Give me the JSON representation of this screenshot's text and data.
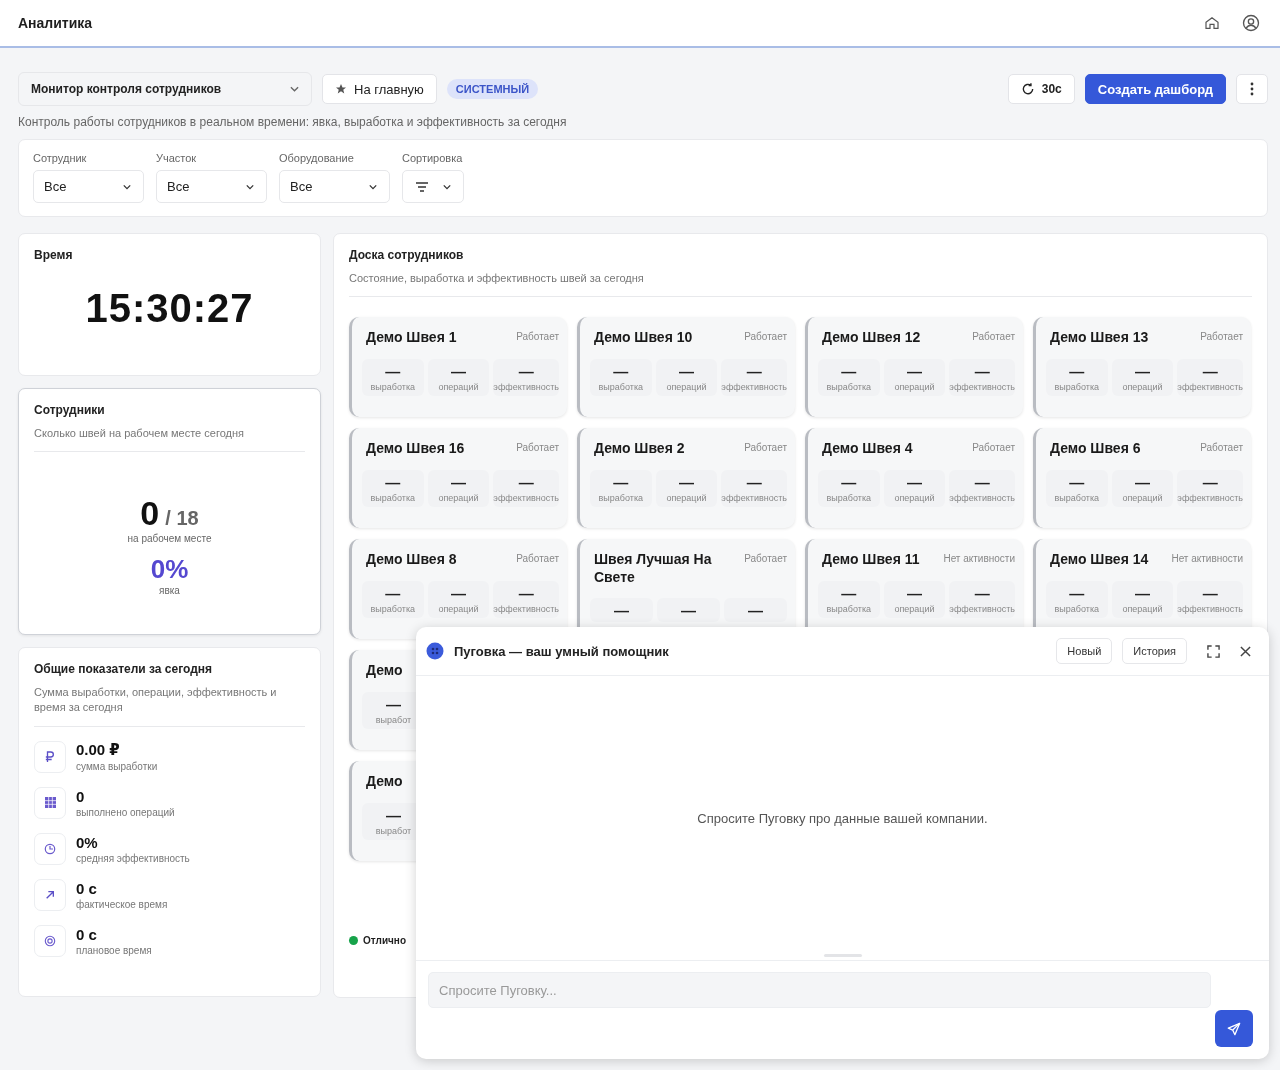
{
  "header": {
    "title": "Аналитика"
  },
  "toolbar": {
    "dashboard": "Монитор контроля сотрудников",
    "home_button": "На главную",
    "badge": "СИСТЕМНЫЙ",
    "refresh": "30с",
    "create_button": "Создать дашборд"
  },
  "description": "Контроль работы сотрудников в реальном времени: явка, выработка и эффективность за сегодня",
  "filters": [
    {
      "label": "Сотрудник",
      "value": "Все",
      "kind": "select"
    },
    {
      "label": "Участок",
      "value": "Все",
      "kind": "select"
    },
    {
      "label": "Оборудование",
      "value": "Все",
      "kind": "select"
    },
    {
      "label": "Сортировка",
      "kind": "sort"
    }
  ],
  "time_card": {
    "title": "Время",
    "time": "15:30:27"
  },
  "employees_card": {
    "title": "Сотрудники",
    "subtitle": "Сколько швей на рабочем месте сегодня",
    "present": "0",
    "total": "/ 18",
    "present_label": "на рабочем месте",
    "attendance": "0%",
    "attendance_label": "явка"
  },
  "totals_card": {
    "title": "Общие показатели за сегодня",
    "subtitle": "Сумма выработки, операции, эффективность и время за сегодня",
    "items": [
      {
        "kind": "ruble",
        "value": "0.00 ₽",
        "label": "сумма выработки"
      },
      {
        "kind": "grid",
        "value": "0",
        "label": "выполнено операций"
      },
      {
        "kind": "clock",
        "value": "0%",
        "label": "средняя эффективность"
      },
      {
        "kind": "arrow",
        "value": "0 с",
        "label": "фактическое время"
      },
      {
        "kind": "target",
        "value": "0 с",
        "label": "плановое время"
      }
    ]
  },
  "board": {
    "title": "Доска сотрудников",
    "subtitle": "Состояние, выработка и эффективность швей за сегодня",
    "rows": [
      [
        {
          "name": "Демо Швея 1",
          "status": "Работает",
          "metrics": [
            {
              "value": "—",
              "label": "выработка"
            },
            {
              "value": "—",
              "label": "операций"
            },
            {
              "value": "—",
              "label": "эффективность"
            }
          ]
        },
        {
          "name": "Демо Швея 10",
          "status": "Работает",
          "metrics": [
            {
              "value": "—",
              "label": "выработка"
            },
            {
              "value": "—",
              "label": "операций"
            },
            {
              "value": "—",
              "label": "эффективность"
            }
          ]
        },
        {
          "name": "Демо Швея 12",
          "status": "Работает",
          "metrics": [
            {
              "value": "—",
              "label": "выработка"
            },
            {
              "value": "—",
              "label": "операций"
            },
            {
              "value": "—",
              "label": "эффективность"
            }
          ]
        },
        {
          "name": "Демо Швея 13",
          "status": "Работает",
          "metrics": [
            {
              "value": "—",
              "label": "выработка"
            },
            {
              "value": "—",
              "label": "операций"
            },
            {
              "value": "—",
              "label": "эффективность"
            }
          ]
        }
      ],
      [
        {
          "name": "Демо Швея 16",
          "status": "Работает",
          "metrics": [
            {
              "value": "—",
              "label": "выработка"
            },
            {
              "value": "—",
              "label": "операций"
            },
            {
              "value": "—",
              "label": "эффективность"
            }
          ]
        },
        {
          "name": "Демо Швея 2",
          "status": "Работает",
          "metrics": [
            {
              "value": "—",
              "label": "выработка"
            },
            {
              "value": "—",
              "label": "операций"
            },
            {
              "value": "—",
              "label": "эффективность"
            }
          ]
        },
        {
          "name": "Демо Швея 4",
          "status": "Работает",
          "metrics": [
            {
              "value": "—",
              "label": "выработка"
            },
            {
              "value": "—",
              "label": "операций"
            },
            {
              "value": "—",
              "label": "эффективность"
            }
          ]
        },
        {
          "name": "Демо Швея 6",
          "status": "Работает",
          "metrics": [
            {
              "value": "—",
              "label": "выработка"
            },
            {
              "value": "—",
              "label": "операций"
            },
            {
              "value": "—",
              "label": "эффективность"
            }
          ]
        }
      ],
      [
        {
          "name": "Демо Швея 8",
          "status": "Работает",
          "metrics": [
            {
              "value": "—",
              "label": "выработка"
            },
            {
              "value": "—",
              "label": "операций"
            },
            {
              "value": "—",
              "label": "эффективность"
            }
          ]
        },
        {
          "name": "Швея Лучшая На Свете",
          "status": "Работает",
          "metrics": [
            {
              "value": "—"
            },
            {
              "value": "—"
            },
            {
              "value": "—"
            }
          ]
        },
        {
          "name": "Демо Швея 11",
          "status": "Нет активности",
          "metrics": [
            {
              "value": "—",
              "label": "выработка"
            },
            {
              "value": "—",
              "label": "операций"
            },
            {
              "value": "—",
              "label": "эффективность"
            }
          ]
        },
        {
          "name": "Демо Швея 14",
          "status": "Нет активности",
          "metrics": [
            {
              "value": "—",
              "label": "выработка"
            },
            {
              "value": "—",
              "label": "операций"
            },
            {
              "value": "—",
              "label": "эффективность"
            }
          ]
        }
      ],
      [
        {
          "name": "Демо",
          "metrics": [
            {
              "value": "—",
              "label": "выработ"
            }
          ]
        }
      ],
      [
        {
          "name": "Демо",
          "metrics": [
            {
              "value": "—",
              "label": "выработ"
            }
          ]
        }
      ]
    ],
    "legend": [
      {
        "label": "Отлично",
        "color": "#16a34a"
      }
    ]
  },
  "assistant": {
    "title": "Пуговка — ваш умный помощник",
    "buttons": [
      "Новый",
      "История"
    ],
    "empty_text": "Спросите Пуговку про данные вашей компании.",
    "placeholder": "Спросите Пуговку..."
  }
}
